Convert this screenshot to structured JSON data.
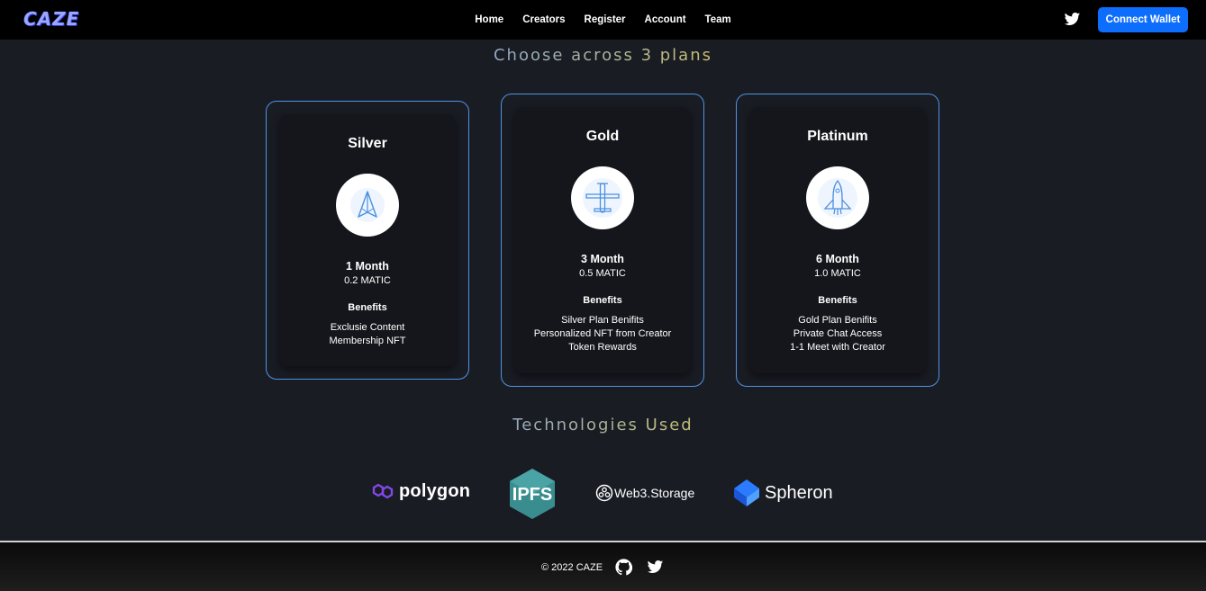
{
  "nav": {
    "logo": "CAZE",
    "links": [
      "Home",
      "Creators",
      "Register",
      "Account",
      "Team"
    ],
    "connect_label": "Connect Wallet",
    "twitter_icon": "twitter-icon"
  },
  "plans_section": {
    "title": "Choose across 3 plans",
    "plans": [
      {
        "name": "Silver",
        "icon": "paper-plane-icon",
        "duration": "1 Month",
        "price": "0.2 MATIC",
        "benefits_title": "Benefits",
        "benefits": [
          "Exclusie Content",
          "Membership NFT"
        ]
      },
      {
        "name": "Gold",
        "icon": "airplane-icon",
        "duration": "3 Month",
        "price": "0.5 MATIC",
        "benefits_title": "Benefits",
        "benefits": [
          "Silver Plan Benifits",
          "Personalized NFT from Creator",
          "Token Rewards"
        ]
      },
      {
        "name": "Platinum",
        "icon": "space-shuttle-icon",
        "duration": "6 Month",
        "price": "1.0 MATIC",
        "benefits_title": "Benefits",
        "benefits": [
          "Gold Plan Benifits",
          "Private Chat Access",
          "1-1 Meet with Creator"
        ]
      }
    ]
  },
  "tech_section": {
    "title": "Technologies Used",
    "items": [
      {
        "name": "polygon",
        "icon": "polygon-logo"
      },
      {
        "name": "IPFS",
        "icon": "ipfs-logo"
      },
      {
        "name": "Web3.Storage",
        "icon": "web3-storage-logo"
      },
      {
        "name": "Spheron",
        "icon": "spheron-logo"
      }
    ]
  },
  "footer": {
    "copyright": "© 2022 CAZE",
    "github_icon": "github-icon",
    "twitter_icon": "twitter-icon"
  },
  "colors": {
    "background": "#1a1c24",
    "nav_background": "#000000",
    "accent_blue": "#0d6efd",
    "card_border": "#4f93e0",
    "polygon_purple": "#8247e5",
    "ipfs_teal": "#3a8d8f"
  }
}
